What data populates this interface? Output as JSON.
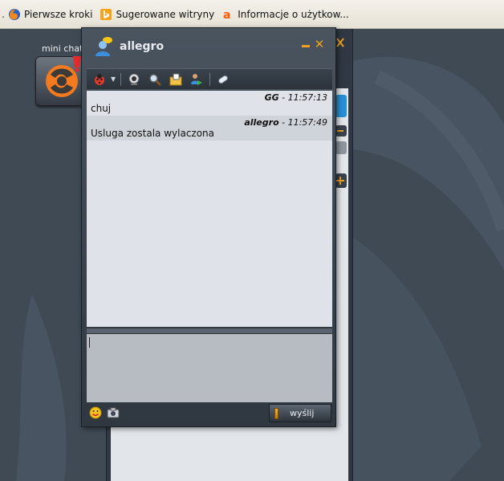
{
  "bookmarks": [
    {
      "label": "Pierwsze kroki",
      "icon": "firefox-icon"
    },
    {
      "label": "Sugerowane witryny",
      "icon": "bing-icon"
    },
    {
      "label": "Informacje o użytkow...",
      "icon": "allegro-icon"
    }
  ],
  "mini_chat": {
    "label": "mini chat"
  },
  "chat": {
    "title": "allegro",
    "messages": [
      {
        "sender": "GG",
        "time": "11:57:13",
        "text": "chuj"
      },
      {
        "sender": "allegro",
        "time": "11:57:49",
        "text": "Usluga zostala wylaczona"
      }
    ],
    "input_value": "",
    "send_label": "wyślij"
  },
  "colors": {
    "accent": "#f0a020",
    "window_bg": "#3a434d",
    "messages_bg": "#dfe2e8",
    "input_bg": "#b7bcc3"
  }
}
